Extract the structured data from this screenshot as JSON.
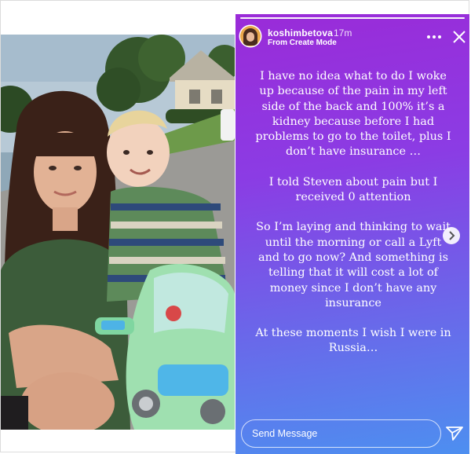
{
  "story": {
    "username": "koshimbetova",
    "time_ago": "17m",
    "subtitle": "From Create Mode",
    "paragraphs": [
      "I have no idea what to do I woke up because of the pain in my left side of the back and 100% it’s a kidney because before I had problems to go to the toilet, plus I don’t have insurance …",
      "I told Steven about pain but I received 0 attention",
      "So I’m laying and thinking to wait until the morning or call a Lyft and to go now? And something is telling that it will cost a lot of money since I don’t have any insurance",
      "At these moments I wish I were in Russia…"
    ],
    "reply_placeholder": "Send Message"
  },
  "icons": {
    "more": "more-horizontal-icon",
    "close": "close-icon",
    "next": "chevron-right-icon",
    "send": "send-paper-plane-icon"
  },
  "colors": {
    "gradient_top": "#9a2bd8",
    "gradient_bottom": "#4d8ff0",
    "text": "#ffffff"
  }
}
